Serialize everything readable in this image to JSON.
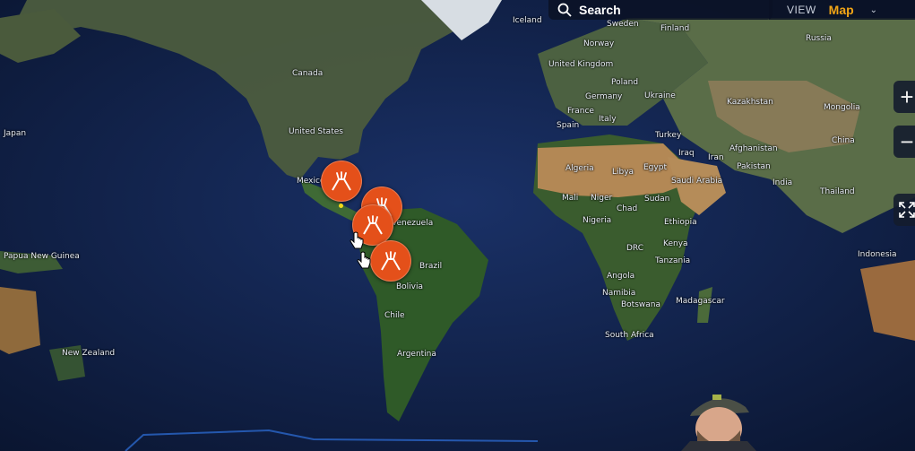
{
  "search": {
    "label": "Search"
  },
  "view_switch": {
    "view_label": "VIEW",
    "mode_label": "Map"
  },
  "zoom_controls": {
    "zoom_in": "+",
    "zoom_out": "−"
  },
  "map_labels": {
    "countries": [
      "Iceland",
      "Sweden",
      "Finland",
      "Norway",
      "Russia",
      "United Kingdom",
      "Poland",
      "Germany",
      "Ukraine",
      "Kazakhstan",
      "Mongolia",
      "France",
      "Italy",
      "Spain",
      "Turkey",
      "Iraq",
      "Iran",
      "Afghanistan",
      "China",
      "Pakistan",
      "India",
      "Thailand",
      "Algeria",
      "Libya",
      "Egypt",
      "Saudi Arabia",
      "Mali",
      "Niger",
      "Sudan",
      "Chad",
      "Nigeria",
      "Ethiopia",
      "DRC",
      "Kenya",
      "Tanzania",
      "Angola",
      "Namibia",
      "Botswana",
      "Madagascar",
      "South Africa",
      "Indonesia",
      "Canada",
      "United States",
      "Mexico",
      "Venezuela",
      "Brazil",
      "Bolivia",
      "Chile",
      "Argentina",
      "Papua New Guinea",
      "New Zealand",
      "Japan"
    ]
  },
  "markers": [
    {
      "name": "volcano-marker-mexico"
    },
    {
      "name": "volcano-marker-central-america"
    },
    {
      "name": "volcano-marker-colombia"
    },
    {
      "name": "volcano-marker-peru"
    }
  ],
  "colors": {
    "ocean": "#0f2147",
    "land": "#3f5a35",
    "desert": "#b78a55",
    "marker": "#e4501a",
    "accent": "#f2a516"
  }
}
